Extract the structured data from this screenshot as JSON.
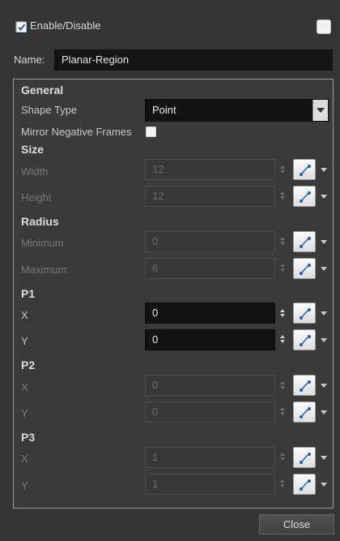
{
  "header": {
    "enable_label": "Enable/Disable",
    "enable_checked": true,
    "name_label": "Name:",
    "name_value": "Planar-Region"
  },
  "general": {
    "title": "General",
    "shape_type_label": "Shape Type",
    "shape_type_value": "Point",
    "mirror_label": "Mirror Negative Frames",
    "mirror_checked": false
  },
  "size": {
    "title": "Size",
    "width_label": "Width",
    "width_value": "12",
    "height_label": "Height",
    "height_value": "12"
  },
  "radius": {
    "title": "Radius",
    "min_label": "Minimum",
    "min_value": "0",
    "max_label": "Maximum",
    "max_value": "6"
  },
  "p1": {
    "title": "P1",
    "x_label": "X",
    "x_value": "0",
    "y_label": "Y",
    "y_value": "0"
  },
  "p2": {
    "title": "P2",
    "x_label": "X",
    "x_value": "0",
    "y_label": "Y",
    "y_value": "0"
  },
  "p3": {
    "title": "P3",
    "x_label": "X",
    "x_value": "1",
    "y_label": "Y",
    "y_value": "1"
  },
  "footer": {
    "close_label": "Close"
  },
  "icons": {
    "function": "function-curve-icon",
    "menu": "dropdown-arrow-icon",
    "spinner": "spinner-arrows-icon"
  },
  "colors": {
    "background": "#353535",
    "input_active": "#121212",
    "accent_blue": "#2a6fc9"
  }
}
